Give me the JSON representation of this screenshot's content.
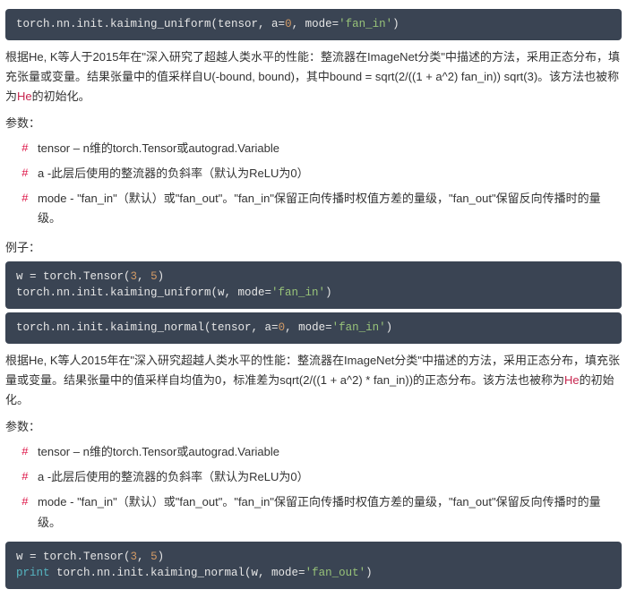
{
  "sec1": {
    "sig_pre": "torch.nn.init.kaiming_uniform(tensor, a=",
    "sig_zero": "0",
    "sig_mid": ", mode=",
    "sig_str": "'fan_in'",
    "sig_post": ")",
    "desc_a": "根据He, K等人于2015年在\"深入研究了超越人类水平的性能：整流器在ImageNet分类\"中描述的方法，采用正态分布，填充张量或变量。结果张量中的值采样自U(-bound, bound)，其中bound = sqrt(2/((1 + a^2) fan_in)) sqrt(3)。该方法也被称为",
    "he": "He",
    "desc_b": "的初始化。",
    "params_label": "参数：",
    "p_tensor": "tensor – n维的torch.Tensor或autograd.Variable",
    "p_a": "a -此层后使用的整流器的负斜率（默认为ReLU为0）",
    "p_mode": "mode - \"fan_in\"（默认）或\"fan_out\"。\"fan_in\"保留正向传播时权值方差的量级，\"fan_out\"保留反向传播时的量级。",
    "ex_label": "例子：",
    "ex_l1a": "w = torch.Tensor(",
    "ex_l1n1": "3",
    "ex_l1sep": ", ",
    "ex_l1n2": "5",
    "ex_l1b": ")",
    "ex_l2a": "torch.nn.init.kaiming_uniform(w, mode=",
    "ex_l2s": "'fan_in'",
    "ex_l2b": ")"
  },
  "sec2": {
    "sig_pre": "torch.nn.init.kaiming_normal(tensor, a=",
    "sig_zero": "0",
    "sig_mid": ", mode=",
    "sig_str": "'fan_in'",
    "sig_post": ")",
    "desc_a": "根据He, K等人2015年在\"深入研究超越人类水平的性能：整流器在ImageNet分类\"中描述的方法，采用正态分布，填充张量或变量。结果张量中的值采样自均值为0，标准差为sqrt(2/((1 + a^2) * fan_in))的正态分布。该方法也被称为",
    "he": "He",
    "desc_b": "的初始化。",
    "params_label": "参数：",
    "p_tensor": "tensor – n维的torch.Tensor或autograd.Variable",
    "p_a": "a -此层后使用的整流器的负斜率（默认为ReLU为0）",
    "p_mode": "mode - \"fan_in\"（默认）或\"fan_out\"。\"fan_in\"保留正向传播时权值方差的量级，\"fan_out\"保留反向传播时的量级。",
    "ex_l1a": "w = torch.Tensor(",
    "ex_l1n1": "3",
    "ex_l1sep": ", ",
    "ex_l1n2": "5",
    "ex_l1b": ")",
    "ex_print": "print",
    "ex_l2a": " torch.nn.init.kaiming_normal(w, mode=",
    "ex_l2s": "'fan_out'",
    "ex_l2b": ")"
  }
}
